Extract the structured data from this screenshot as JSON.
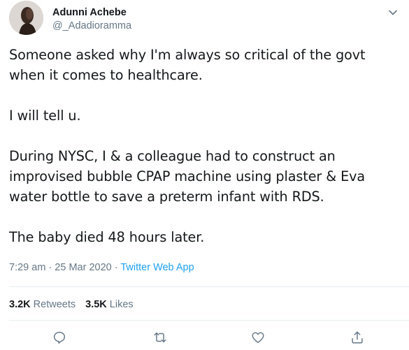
{
  "user": {
    "display_name": "Adunni Achebe",
    "handle": "@_Adadioramma"
  },
  "tweet": {
    "paragraphs": [
      "Someone asked why I'm always so critical of the govt when it comes to healthcare.",
      "I will tell u.",
      "During NYSC, I & a colleague had to construct an improvised bubble CPAP machine using plaster & Eva water bottle to save a preterm infant with RDS.",
      "The baby died 48 hours later."
    ],
    "time": "7:29 am",
    "separator_1": " · ",
    "date": "25 Mar 2020",
    "separator_2": " · ",
    "source": "Twitter Web App"
  },
  "stats": {
    "retweets_count": "3.2K",
    "retweets_label": "Retweets",
    "likes_count": "3.5K",
    "likes_label": "Likes"
  },
  "icons": {
    "caret": "chevron-down-icon",
    "reply": "reply-icon",
    "retweet": "retweet-icon",
    "like": "heart-icon",
    "share": "share-icon"
  },
  "colors": {
    "text": "#14171a",
    "secondary": "#657786",
    "link": "#1da1f2",
    "divider": "#e6ecf0"
  }
}
